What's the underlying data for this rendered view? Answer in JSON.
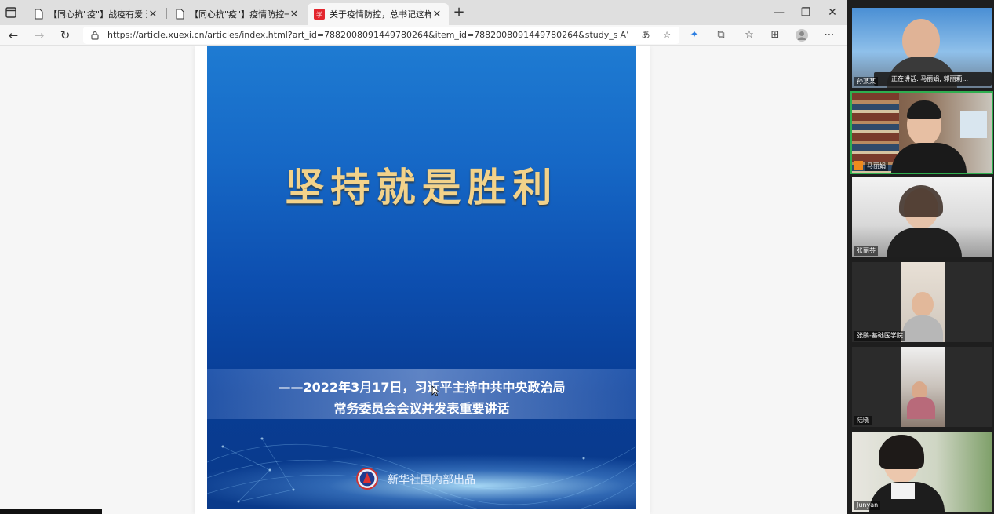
{
  "browser": {
    "tabs": [
      {
        "title": "【同心抗\"疫\"】战疫有爱 逆行无惧",
        "active": false
      },
      {
        "title": "【同心抗\"疫\"】疫情防控一线\"尖",
        "active": false
      },
      {
        "title": "关于疫情防控，总书记这样说",
        "active": true
      }
    ],
    "newtab_label": "+",
    "window_controls": [
      "—",
      "❐",
      "✕"
    ],
    "url": "https://article.xuexi.cn/articles/index.html?art_id=7882008091449780264&item_id=7882008091449780264&study_style_id=feeds_defaul..."
  },
  "poster": {
    "headline": "坚持就是胜利",
    "subtitle_line1": "——2022年3月17日，习近平主持中共中央政治局",
    "subtitle_line2": "常务委员会会议并发表重要讲话",
    "credit": "新华社国内部出品"
  },
  "participants": {
    "speaking_banner": "正在讲话: 马丽娟; 郭丽莉...",
    "tiles": [
      {
        "name": "孙某某",
        "speaking": false
      },
      {
        "name": "马丽娟",
        "speaking": true
      },
      {
        "name": "张丽芬",
        "speaking": false
      },
      {
        "name": "张鹏-基础医学院",
        "speaking": false
      },
      {
        "name": "陆晓",
        "speaking": false
      },
      {
        "name": "Junyan",
        "speaking": false
      }
    ]
  },
  "colors": {
    "accent_green": "#2fae4f",
    "poster_gold": "#f2d28a",
    "poster_blue": "#0d4fb0"
  }
}
